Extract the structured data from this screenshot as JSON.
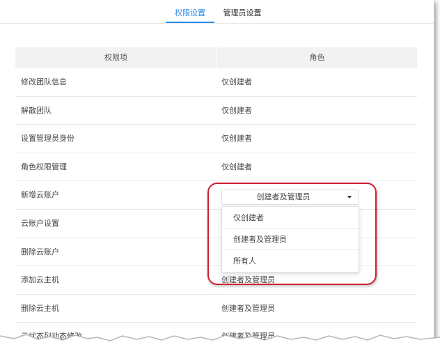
{
  "tabs": [
    {
      "label": "权限设置",
      "active": true
    },
    {
      "label": "管理员设置",
      "active": false
    }
  ],
  "table": {
    "headers": [
      "权限项",
      "角色"
    ],
    "rows": [
      {
        "permission": "修改团队信息",
        "role": "仅创建者"
      },
      {
        "permission": "解散团队",
        "role": "仅创建者"
      },
      {
        "permission": "设置管理员身份",
        "role": "仅创建者"
      },
      {
        "permission": "角色权限管理",
        "role": "仅创建者"
      },
      {
        "permission": "新增云账户",
        "role": ""
      },
      {
        "permission": "云账户设置",
        "role": ""
      },
      {
        "permission": "删除云账户",
        "role": ""
      },
      {
        "permission": "添加云主机",
        "role": "创建者及管理员"
      },
      {
        "permission": "删除云主机",
        "role": "创建者及管理员"
      },
      {
        "permission": "云状态列动态修改",
        "role": "创建者及管理员"
      }
    ]
  },
  "role_select": {
    "value": "创建者及管理员",
    "options": [
      "仅创建者",
      "创建者及管理员",
      "所有人"
    ]
  },
  "colors": {
    "accent": "#2d8cf0",
    "highlight": "#cc1f2f"
  }
}
